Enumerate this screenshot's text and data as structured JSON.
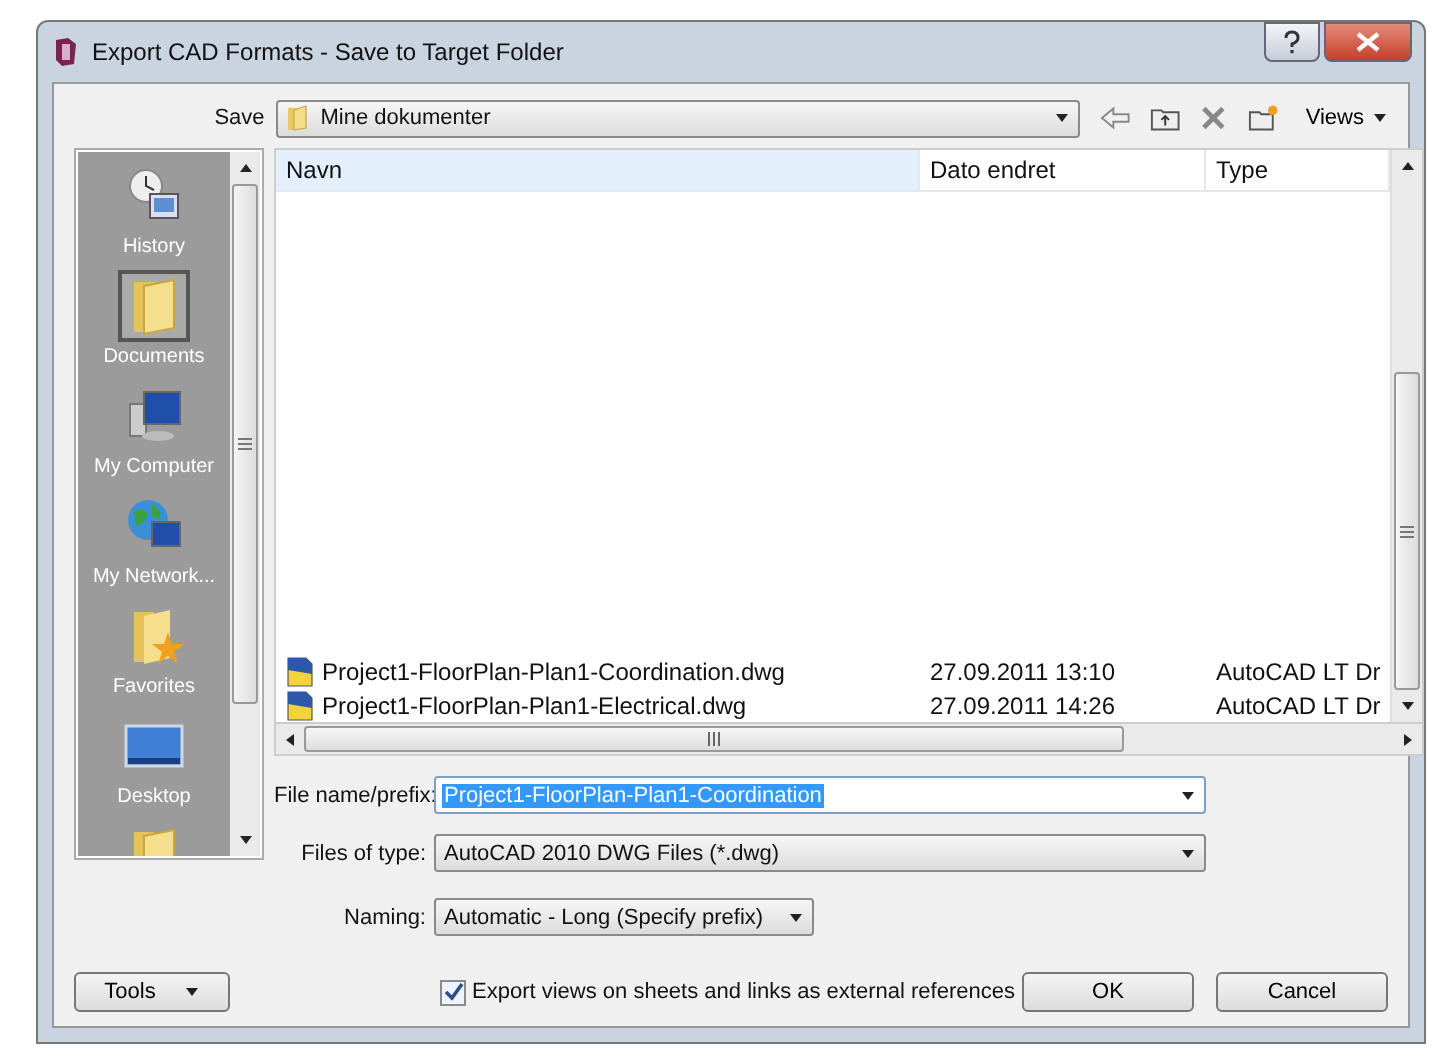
{
  "window": {
    "title": "Export CAD Formats - Save to Target Folder"
  },
  "save_in": {
    "label": "Save",
    "value": "Mine dokumenter"
  },
  "toolbar": {
    "views_label": "Views"
  },
  "places": [
    {
      "label": "History",
      "kind": "history",
      "selected": false
    },
    {
      "label": "Documents",
      "kind": "documents",
      "selected": true
    },
    {
      "label": "My Computer",
      "kind": "computer",
      "selected": false
    },
    {
      "label": "My Network...",
      "kind": "network",
      "selected": false
    },
    {
      "label": "Favorites",
      "kind": "favorites",
      "selected": false
    },
    {
      "label": "Desktop",
      "kind": "desktop",
      "selected": false
    },
    {
      "kind": "folder",
      "selected": false
    }
  ],
  "file_list": {
    "columns": [
      "Navn",
      "Dato endret",
      "Type"
    ],
    "rows": [
      {
        "name": "Project1-FloorPlan-Plan1-Coordination.dwg",
        "date": "27.09.2011 13:10",
        "type": "AutoCAD LT Dr"
      },
      {
        "name": "Project1-FloorPlan-Plan1-Electrical.dwg",
        "date": "27.09.2011 14:26",
        "type": "AutoCAD LT Dr"
      }
    ]
  },
  "file_name": {
    "label": "File name/prefix:",
    "value": "Project1-FloorPlan-Plan1-Coordination"
  },
  "file_type": {
    "label": "Files of type:",
    "value": "AutoCAD 2010 DWG Files  (*.dwg)"
  },
  "naming": {
    "label": "Naming:",
    "value": "Automatic - Long (Specify prefix)"
  },
  "tools_button": "Tools",
  "export_links": {
    "label": "Export views on sheets and links as external references",
    "checked": true
  },
  "buttons": [
    "OK",
    "Cancel"
  ]
}
